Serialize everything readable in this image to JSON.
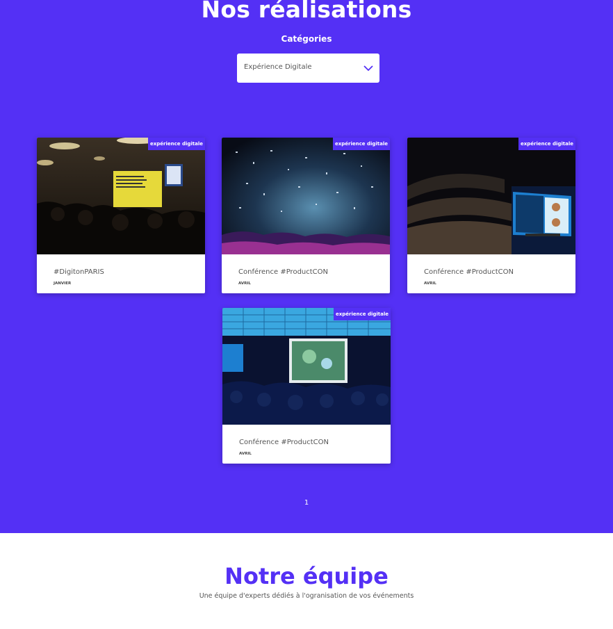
{
  "realisations": {
    "title": "Nos réalisations",
    "categories_label": "Catégories",
    "selected_category": "Expérience Digitale",
    "accent_color": "#5430f5",
    "cards": [
      {
        "tag": "expérience digitale",
        "title": "#DigitonPARIS",
        "date": "JANVIER"
      },
      {
        "tag": "expérience digitale",
        "title": "Conférence #ProductCON",
        "date": "AVRIL"
      },
      {
        "tag": "expérience digitale",
        "title": "Conférence #ProductCON",
        "date": "AVRIL"
      },
      {
        "tag": "expérience digitale",
        "title": "Conférence #ProductCON",
        "date": "AVRIL"
      }
    ],
    "pagination": {
      "current_page": "1"
    }
  },
  "equipe": {
    "title": "Notre équipe",
    "subtitle": "Une équipe d'experts dédiés à l'ogranisation de vos événements"
  }
}
